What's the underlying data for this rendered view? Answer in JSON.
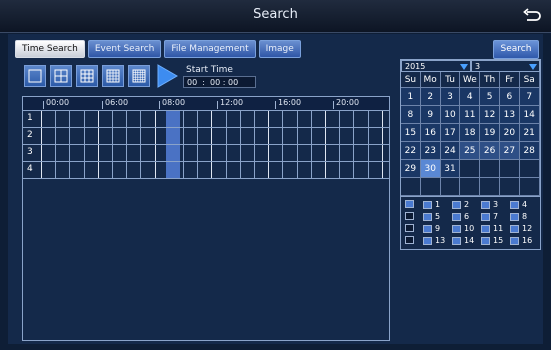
{
  "title": "Search",
  "tabs": [
    {
      "label": "Time Search",
      "active": true
    },
    {
      "label": "Event Search",
      "active": false
    },
    {
      "label": "File Management",
      "active": false
    },
    {
      "label": "Image",
      "active": false
    }
  ],
  "search_button": "Search",
  "layout_buttons": [
    "layout-1-icon",
    "layout-4-icon",
    "layout-9-icon",
    "layout-16-icon",
    "layout-25-icon"
  ],
  "start_time": {
    "label": "Start Time",
    "value": "00  :  00 : 00"
  },
  "timeline": {
    "ticks": [
      "00:00",
      "06:00",
      "08:00",
      "12:00",
      "16:00",
      "20:00"
    ],
    "channels": [
      "1",
      "2",
      "3",
      "4"
    ]
  },
  "calendar": {
    "year": "2015",
    "month": "3",
    "weekdays": [
      "Su",
      "Mo",
      "Tu",
      "We",
      "Th",
      "Fr",
      "Sa"
    ],
    "days": [
      "1",
      "2",
      "3",
      "4",
      "5",
      "6",
      "7",
      "8",
      "9",
      "10",
      "11",
      "12",
      "13",
      "14",
      "15",
      "16",
      "17",
      "18",
      "19",
      "20",
      "21",
      "22",
      "23",
      "24",
      "25",
      "26",
      "27",
      "28",
      "29",
      "30",
      "31"
    ],
    "selected_day": "30",
    "record_days": [
      "25",
      "26",
      "27"
    ]
  },
  "channel_select": {
    "all_checked": true,
    "items": [
      "1",
      "2",
      "3",
      "4",
      "5",
      "6",
      "7",
      "8",
      "9",
      "10",
      "11",
      "12",
      "13",
      "14",
      "15",
      "16"
    ]
  },
  "colors": {
    "accent": "#4a72c4",
    "panel": "#14294a",
    "background": "#0e1e36"
  }
}
